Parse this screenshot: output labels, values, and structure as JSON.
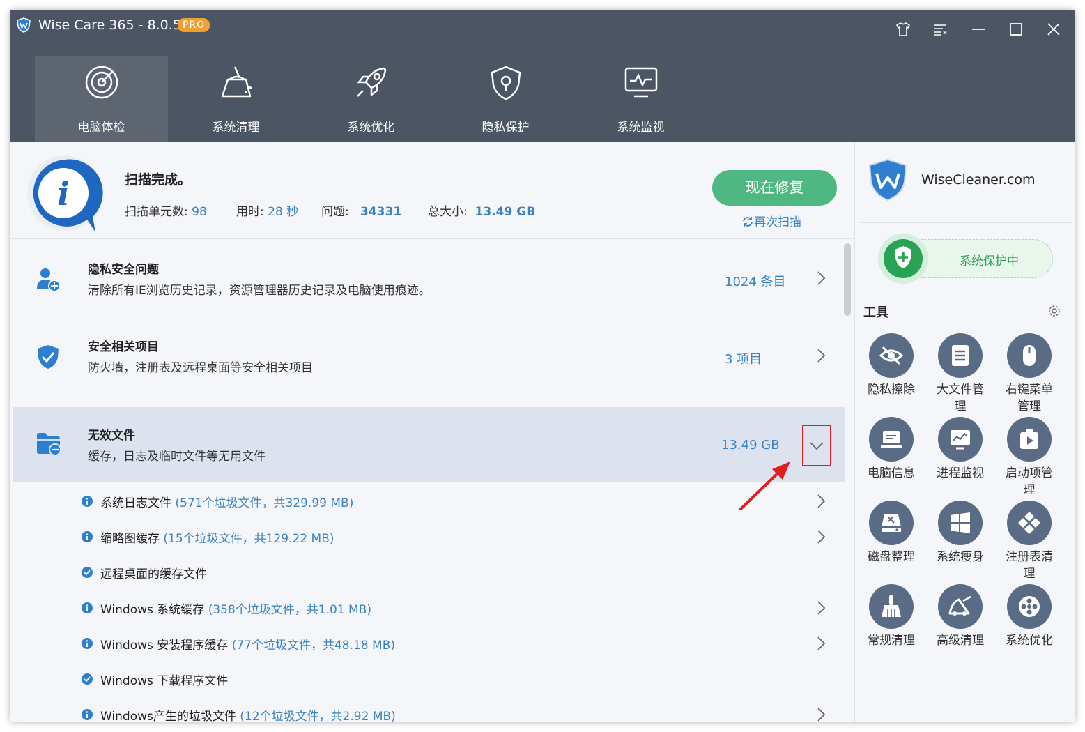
{
  "app": {
    "title": "Wise Care 365 - 8.0.5",
    "badge": "PRO"
  },
  "nav": {
    "tabs": [
      {
        "label": "电脑体检"
      },
      {
        "label": "系统清理"
      },
      {
        "label": "系统优化"
      },
      {
        "label": "隐私保护"
      },
      {
        "label": "系统监视"
      }
    ]
  },
  "summary": {
    "heading": "扫描完成。",
    "units_label": "扫描单元数:",
    "units_value": "98",
    "time_label": "用时:",
    "time_value": "28 秒",
    "issues_label": "问题:",
    "issues_value": "34331",
    "size_label": "总大小:",
    "size_value": "13.49 GB",
    "fix_button": "现在修复",
    "rescan": "再次扫描"
  },
  "categories": [
    {
      "title": "隐私安全问题",
      "desc": "清除所有IE浏览历史记录，资源管理器历史记录及电脑使用痕迹。",
      "count": "1024 条目"
    },
    {
      "title": "安全相关项目",
      "desc": "防火墙，注册表及远程桌面等安全相关项目",
      "count": "3 项目"
    },
    {
      "title": "无效文件",
      "desc": "缓存，日志及临时文件等无用文件",
      "count": "13.49 GB"
    }
  ],
  "subitems": [
    {
      "name": "系统日志文件",
      "detail": "(571个垃圾文件，共329.99 MB)"
    },
    {
      "name": "缩略图缓存",
      "detail": "(15个垃圾文件，共129.22 MB)"
    },
    {
      "name": "远程桌面的缓存文件",
      "detail": ""
    },
    {
      "name": "Windows 系统缓存",
      "detail": "(358个垃圾文件，共1.01 MB)"
    },
    {
      "name": "Windows 安装程序缓存",
      "detail": "(77个垃圾文件，共48.18 MB)"
    },
    {
      "name": "Windows 下载程序文件",
      "detail": ""
    },
    {
      "name": "Windows产生的垃圾文件",
      "detail": "(12个垃圾文件，共2.92 MB)"
    }
  ],
  "sidebar": {
    "brand": "WiseCleaner.com",
    "protection": "系统保护中",
    "tools_title": "工具",
    "tools": [
      {
        "label": "隐私擦除",
        "icon": "eye-slash-icon"
      },
      {
        "label": "大文件管理",
        "icon": "file-list-icon"
      },
      {
        "label": "右键菜单管理",
        "icon": "mouse-icon"
      },
      {
        "label": "电脑信息",
        "icon": "laptop-icon"
      },
      {
        "label": "进程监视",
        "icon": "monitor-chart-icon"
      },
      {
        "label": "启动项管理",
        "icon": "startup-icon"
      },
      {
        "label": "磁盘整理",
        "icon": "disk-defrag-icon"
      },
      {
        "label": "系统瘦身",
        "icon": "windows-icon"
      },
      {
        "label": "注册表清理",
        "icon": "registry-icon"
      },
      {
        "label": "常规清理",
        "icon": "broom-icon"
      },
      {
        "label": "高级清理",
        "icon": "advanced-clean-icon"
      },
      {
        "label": "系统优化",
        "icon": "gear-flower-icon"
      }
    ]
  },
  "colors": {
    "accent": "#3b82c4",
    "fix_button": "#4fb882",
    "titlebar": "#4b5563",
    "selected_row": "#dce3ee",
    "protect_green": "#2aa255"
  }
}
